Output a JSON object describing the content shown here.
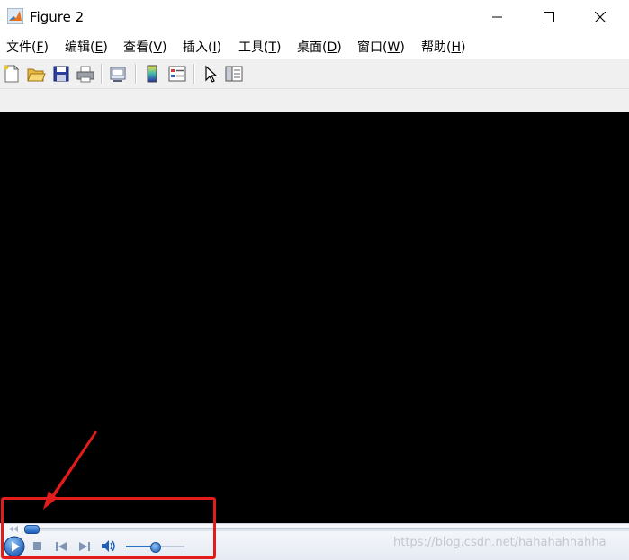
{
  "window": {
    "title": "Figure 2",
    "icons": {
      "app": "matlab-logo-icon",
      "minimize": "minimize-icon",
      "maximize": "maximize-icon",
      "close": "close-icon"
    }
  },
  "menu": {
    "items": [
      {
        "label": "文件(",
        "key": "F",
        "suffix": ")"
      },
      {
        "label": "编辑(",
        "key": "E",
        "suffix": ")"
      },
      {
        "label": "查看(",
        "key": "V",
        "suffix": ")"
      },
      {
        "label": "插入(",
        "key": "I",
        "suffix": ")"
      },
      {
        "label": "工具(",
        "key": "T",
        "suffix": ")"
      },
      {
        "label": "桌面(",
        "key": "D",
        "suffix": ")"
      },
      {
        "label": "窗口(",
        "key": "W",
        "suffix": ")"
      },
      {
        "label": "帮助(",
        "key": "H",
        "suffix": ")"
      }
    ]
  },
  "toolbar": {
    "icons": [
      "new-figure-icon",
      "open-file-icon",
      "save-icon",
      "print-icon",
      "link-plot-icon",
      "insert-colorbar-icon",
      "insert-legend-icon",
      "edit-plot-pointer-icon",
      "property-inspector-icon"
    ]
  },
  "player": {
    "icons": [
      "rewind-icon",
      "play-icon",
      "stop-icon",
      "previous-icon",
      "next-icon",
      "volume-icon"
    ],
    "seek_position": 0.02,
    "volume_level": 0.5
  },
  "watermark": "https://blog.csdn.net/hahahahhahha",
  "annotation": {
    "color": "#e21b1b"
  }
}
